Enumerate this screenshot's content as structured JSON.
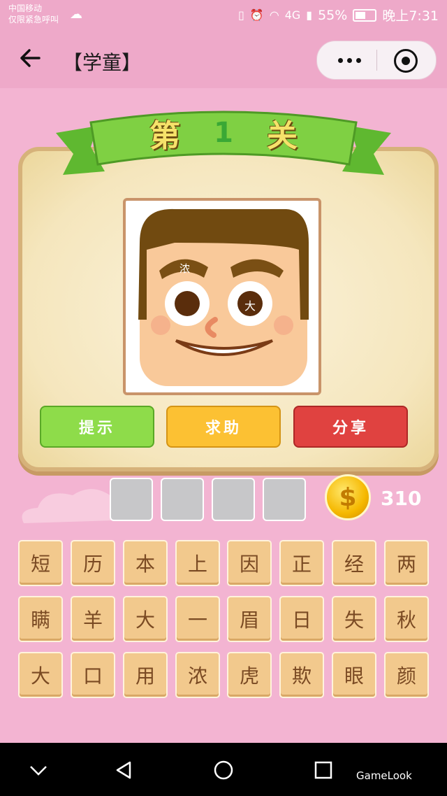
{
  "status_bar": {
    "carrier_line1": "中国移动",
    "carrier_line2": "仅限紧急呼叫",
    "battery": "55%",
    "time": "晚上7:31",
    "signal": "4G"
  },
  "nav": {
    "title": "【学童】"
  },
  "level": {
    "prefix": "第",
    "number": "1",
    "suffix": "关"
  },
  "picture": {
    "eyebrow_char": "浓",
    "eye_char": "大"
  },
  "buttons": {
    "hint": "提示",
    "help": "求助",
    "share": "分享"
  },
  "answer_slots": [
    "",
    "",
    "",
    ""
  ],
  "coins": {
    "count": "310",
    "symbol": "$"
  },
  "letters": [
    [
      "短",
      "历",
      "本",
      "上",
      "因",
      "正",
      "经",
      "两"
    ],
    [
      "瞒",
      "羊",
      "大",
      "一",
      "眉",
      "日",
      "失",
      "秋"
    ],
    [
      "大",
      "口",
      "用",
      "浓",
      "虎",
      "欺",
      "眼",
      "颜"
    ]
  ],
  "watermark": "GameLook",
  "colors": {
    "background": "#f3b4d2",
    "hint_button": "#8edc4a",
    "help_button": "#fcc133",
    "share_button": "#e04240",
    "tile": "#f2c98d"
  }
}
